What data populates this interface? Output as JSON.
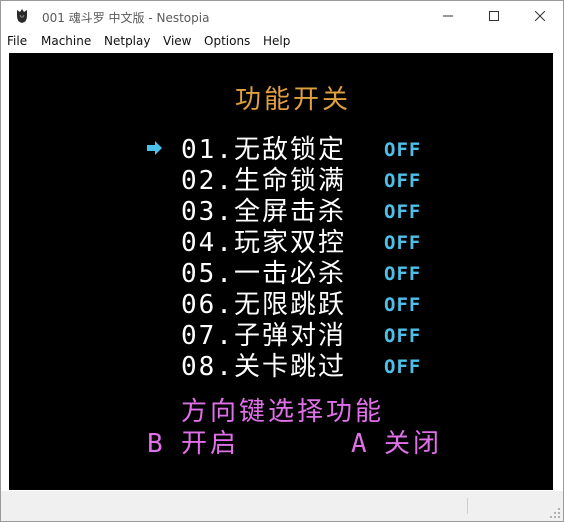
{
  "window": {
    "title": "001 魂斗罗 中文版 - Nestopia",
    "app_icon": "nestopia-app-icon",
    "minimize_icon": "minimize-icon",
    "maximize_icon": "maximize-icon",
    "close_icon": "close-icon"
  },
  "menubar": {
    "items": [
      "File",
      "Machine",
      "Netplay",
      "View",
      "Options",
      "Help"
    ]
  },
  "game": {
    "heading": "功能开关",
    "cursor_icon": "arrow-right-icon",
    "selected_index": 0,
    "options": [
      {
        "label": "01.无敌锁定",
        "state": "OFF"
      },
      {
        "label": "02.生命锁满",
        "state": "OFF"
      },
      {
        "label": "03.全屏击杀",
        "state": "OFF"
      },
      {
        "label": "04.玩家双控",
        "state": "OFF"
      },
      {
        "label": "05.一击必杀",
        "state": "OFF"
      },
      {
        "label": "06.无限跳跃",
        "state": "OFF"
      },
      {
        "label": "07.子弹对消",
        "state": "OFF"
      },
      {
        "label": "08.关卡跳过",
        "state": "OFF"
      }
    ],
    "hint_line": "方向键选择功能",
    "b_key": "B",
    "b_action": "开启",
    "a_key": "A",
    "a_action": "关闭"
  },
  "colors": {
    "screen_bg": "#000000",
    "heading": "#e0a040",
    "option_text": "#ffffff",
    "state_text": "#4cc0e8",
    "hint_text": "#e070e8"
  }
}
